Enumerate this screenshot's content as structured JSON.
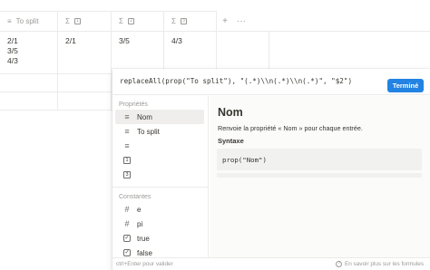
{
  "table": {
    "columns": [
      {
        "icon": "text-lines-icon",
        "label": "To split"
      },
      {
        "icon": "sigma-icon",
        "box": "1"
      },
      {
        "icon": "sigma-icon",
        "box": "2"
      },
      {
        "icon": "sigma-icon",
        "box": "3"
      }
    ],
    "add_symbol": "+",
    "more_symbol": "···",
    "row": [
      "2/1\n3/5\n4/3",
      "2/1",
      "3/5",
      "4/3"
    ]
  },
  "formula": {
    "input": "replaceAll(prop(\"To split\"), \"(.*)\\\\n(.*)\\\\n(.*)\", \"$2\")",
    "done_label": "Terminé"
  },
  "sidebar": {
    "properties_title": "Propriétés",
    "properties": [
      {
        "icon": "text-lines-icon",
        "label": "Nom",
        "selected": true
      },
      {
        "icon": "text-lines-icon",
        "label": "To split"
      },
      {
        "icon": "text-lines-icon",
        "label": ""
      },
      {
        "icon": "box-icon",
        "box": "1",
        "label": ""
      },
      {
        "icon": "box-icon",
        "box": "3",
        "label": ""
      }
    ],
    "constants_title": "Constantes",
    "constants": [
      {
        "icon": "hash-icon",
        "label": "e"
      },
      {
        "icon": "hash-icon",
        "label": "pi"
      },
      {
        "icon": "checkbox-icon",
        "label": "true"
      },
      {
        "icon": "checkbox-icon",
        "label": "false"
      }
    ]
  },
  "doc": {
    "title": "Nom",
    "description": "Renvoie la propriété « Nom » pour chaque entrée.",
    "syntax_label": "Syntaxe",
    "code": "prop(\"Nom\")"
  },
  "footer": {
    "hint": "ctrl+Enter pour valider",
    "help": "En savoir plus sur les formules"
  }
}
